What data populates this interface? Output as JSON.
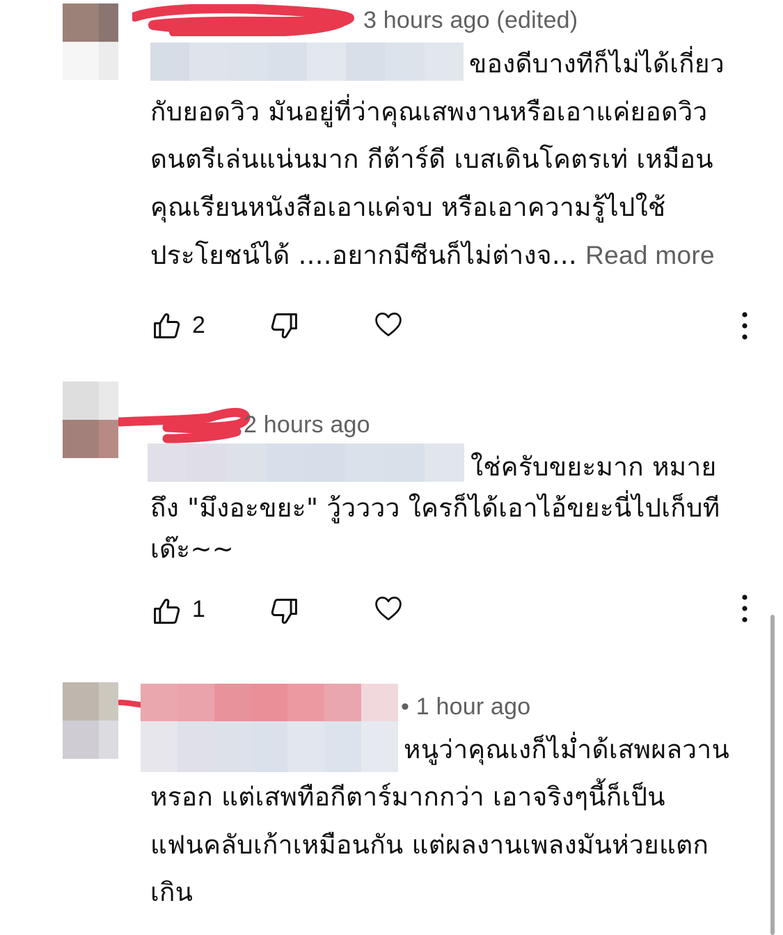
{
  "comments": [
    {
      "timestamp": "3 hours ago (edited)",
      "first_line_after_mention": "ของดีบางทีก็ไม่ได้เกี่ยว",
      "lines": [
        "กับยอดวิว มันอยู่ที่ว่าคุณเสพงานหรือเอาแค่ยอดวิว",
        "ดนตรีเล่นแน่นมาก กีต้าร์ดี เบสเดินโคตรเท่ เหมือน",
        "คุณเรียนหนังสือเอาแค่จบ หรือเอาความรู้ไปใช้"
      ],
      "last_line": "ประโยชน์ได้ ....อยากมีซีนก็ไม่ต่างจ...",
      "read_more": "Read more",
      "likes": "2"
    },
    {
      "timestamp": "2 hours ago",
      "first_line_after_mention": "ใช่ครับขยะมาก หมาย",
      "lines": [
        "ถึง \"มึงอะขยะ\" วู้วววว ใครก็ได้เอาไอ้ขยะนี่ไปเก็บที",
        "เด๊ะ~~"
      ],
      "likes": "1"
    },
    {
      "timestamp": "• 1 hour ago",
      "first_line_after_mention": "หนูว่าคุณเงก็ไม่ำด้เสพผลวาน",
      "lines": [
        "หรอก แต่เสพทือกีตาร์มากกว่า  เอาจริงๆนี้ก็เป็น",
        "แฟนคลับเก้าเหมือนกัน แต่ผลงานเพลงมันห่วยแตก",
        "เกิน"
      ]
    }
  ],
  "icons": {
    "like": "thumbs-up-icon",
    "dislike": "thumbs-down-icon",
    "heart": "heart-icon",
    "menu": "more-vert-icon"
  },
  "colors": {
    "scribble": "#e8394f",
    "meta_text": "#606060",
    "body_text": "#0f0f0f"
  }
}
